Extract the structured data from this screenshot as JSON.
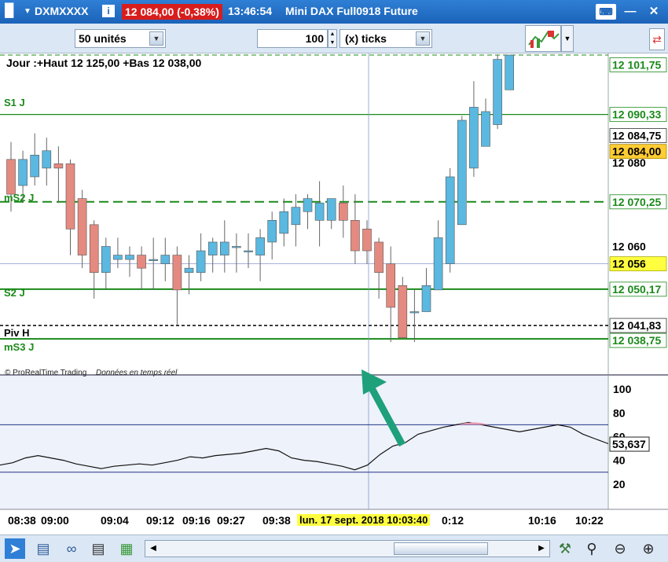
{
  "window": {
    "symbol": "DXMXXXX",
    "info_icon": "i",
    "price_change": "12 084,00 (-0,38%)",
    "time": "13:46:54",
    "instrument": "Mini DAX Full0918 Future"
  },
  "toolbar": {
    "units_value": "50 unités",
    "ticks_value": "100",
    "ticks_label": "(x) ticks"
  },
  "chart": {
    "header": "Jour :+Haut 12 125,00 +Bas 12 038,00",
    "copyright": "© ProRealTime Trading",
    "realtime": "Données en temps réel",
    "cursor_date": "lun. 17 sept. 2018 10:03:40",
    "level_labels": {
      "s1j": "S1 J",
      "ms2j": "mS2 J",
      "s2j": "S2 J",
      "pivh": "Piv H",
      "ms3j": "mS3 J"
    },
    "price_tags": {
      "p1": "12 101,75",
      "p2": "12 090,33",
      "p3": "12 084,75",
      "p4": "12 084,00",
      "p5": "12 080",
      "p6": "12 070,25",
      "p7": "12 060",
      "p8": "12 056",
      "p9": "12 050,17",
      "p10": "12 041,83",
      "p11": "12 038,75"
    },
    "osc_ticks": [
      "100",
      "80",
      "60",
      "40",
      "20"
    ],
    "osc_value": "53,637",
    "time_labels": [
      "08:38",
      "09:00",
      "09:04",
      "09:12",
      "09:16",
      "09:27",
      "09:38",
      "0:12",
      "10:16",
      "10:22"
    ]
  },
  "chart_data": {
    "type": "candlestick",
    "title": "Mini DAX Full0918 Future",
    "y_range": [
      12031,
      12104
    ],
    "up_color": "#5bb8e0",
    "down_color": "#e58a80",
    "levels": [
      {
        "name": "S1 J",
        "value": 12090.33
      },
      {
        "name": "mS2 J",
        "value": 12070.25
      },
      {
        "name": "S2 J",
        "value": 12050.17
      },
      {
        "name": "Piv H",
        "value": 12041.83
      },
      {
        "name": "mS3 J",
        "value": 12038.75
      }
    ],
    "candles": [
      {
        "o": 12080,
        "c": 12072,
        "h": 12084,
        "l": 12068
      },
      {
        "o": 12074,
        "c": 12080,
        "h": 12082,
        "l": 12070
      },
      {
        "o": 12076,
        "c": 12081,
        "h": 12086,
        "l": 12074
      },
      {
        "o": 12078,
        "c": 12082,
        "h": 12085,
        "l": 12074
      },
      {
        "o": 12079,
        "c": 12078,
        "h": 12083,
        "l": 12070
      },
      {
        "o": 12079,
        "c": 12064,
        "h": 12080,
        "l": 12058
      },
      {
        "o": 12071,
        "c": 12058,
        "h": 12073,
        "l": 12055
      },
      {
        "o": 12065,
        "c": 12054,
        "h": 12066,
        "l": 12048
      },
      {
        "o": 12054,
        "c": 12060,
        "h": 12062,
        "l": 12050
      },
      {
        "o": 12057,
        "c": 12058,
        "h": 12062,
        "l": 12055
      },
      {
        "o": 12057,
        "c": 12058,
        "h": 12060,
        "l": 12053
      },
      {
        "o": 12058,
        "c": 12055,
        "h": 12060,
        "l": 12050
      },
      {
        "o": 12057,
        "c": 12057,
        "h": 12062,
        "l": 12050
      },
      {
        "o": 12056,
        "c": 12058,
        "h": 12062,
        "l": 12052
      },
      {
        "o": 12058,
        "c": 12050,
        "h": 12060,
        "l": 12042
      },
      {
        "o": 12054,
        "c": 12055,
        "h": 12058,
        "l": 12049
      },
      {
        "o": 12054,
        "c": 12059,
        "h": 12063,
        "l": 12052
      },
      {
        "o": 12058,
        "c": 12061,
        "h": 12062,
        "l": 12054
      },
      {
        "o": 12058,
        "c": 12061,
        "h": 12066,
        "l": 12054
      },
      {
        "o": 12060,
        "c": 12060,
        "h": 12063,
        "l": 12054
      },
      {
        "o": 12059,
        "c": 12059,
        "h": 12063,
        "l": 12055
      },
      {
        "o": 12058,
        "c": 12062,
        "h": 12064,
        "l": 12052
      },
      {
        "o": 12061,
        "c": 12066,
        "h": 12068,
        "l": 12057
      },
      {
        "o": 12063,
        "c": 12068,
        "h": 12071,
        "l": 12060
      },
      {
        "o": 12065,
        "c": 12069,
        "h": 12072,
        "l": 12060
      },
      {
        "o": 12068,
        "c": 12071,
        "h": 12072,
        "l": 12064
      },
      {
        "o": 12066,
        "c": 12070,
        "h": 12075,
        "l": 12060
      },
      {
        "o": 12066,
        "c": 12071,
        "h": 12071,
        "l": 12064
      },
      {
        "o": 12070,
        "c": 12066,
        "h": 12074,
        "l": 12062
      },
      {
        "o": 12066,
        "c": 12059,
        "h": 12072,
        "l": 12056
      },
      {
        "o": 12064,
        "c": 12059,
        "h": 12066,
        "l": 12056
      },
      {
        "o": 12061,
        "c": 12054,
        "h": 12062,
        "l": 12048
      },
      {
        "o": 12056,
        "c": 12046,
        "h": 12060,
        "l": 12038
      },
      {
        "o": 12051,
        "c": 12039,
        "h": 12053,
        "l": 12039
      },
      {
        "o": 12045,
        "c": 12045,
        "h": 12050,
        "l": 12038
      },
      {
        "o": 12045,
        "c": 12051,
        "h": 12055,
        "l": 12045
      },
      {
        "o": 12050,
        "c": 12062,
        "h": 12066,
        "l": 12050
      },
      {
        "o": 12056,
        "c": 12076,
        "h": 12078,
        "l": 12054
      },
      {
        "o": 12065,
        "c": 12089,
        "h": 12090,
        "l": 12065
      },
      {
        "o": 12078,
        "c": 12092,
        "h": 12098,
        "l": 12076
      },
      {
        "o": 12083,
        "c": 12091,
        "h": 12094,
        "l": 12083
      },
      {
        "o": 12088,
        "c": 12103,
        "h": 12104,
        "l": 12087
      },
      {
        "o": 12096,
        "c": 12104,
        "h": 12104,
        "l": 12096
      }
    ],
    "oscillator": {
      "ylim": [
        0,
        110
      ],
      "levels": [
        70,
        30
      ],
      "last_value": 53.637,
      "values": [
        36,
        38,
        42,
        44,
        42,
        40,
        37,
        35,
        33,
        35,
        36,
        37,
        36,
        38,
        40,
        43,
        42,
        44,
        45,
        46,
        48,
        50,
        48,
        42,
        40,
        39,
        37,
        35,
        32,
        36,
        45,
        52,
        55,
        62,
        65,
        68,
        70,
        72,
        70,
        68,
        66,
        64,
        66,
        68,
        70,
        68,
        62,
        58,
        54
      ]
    }
  }
}
